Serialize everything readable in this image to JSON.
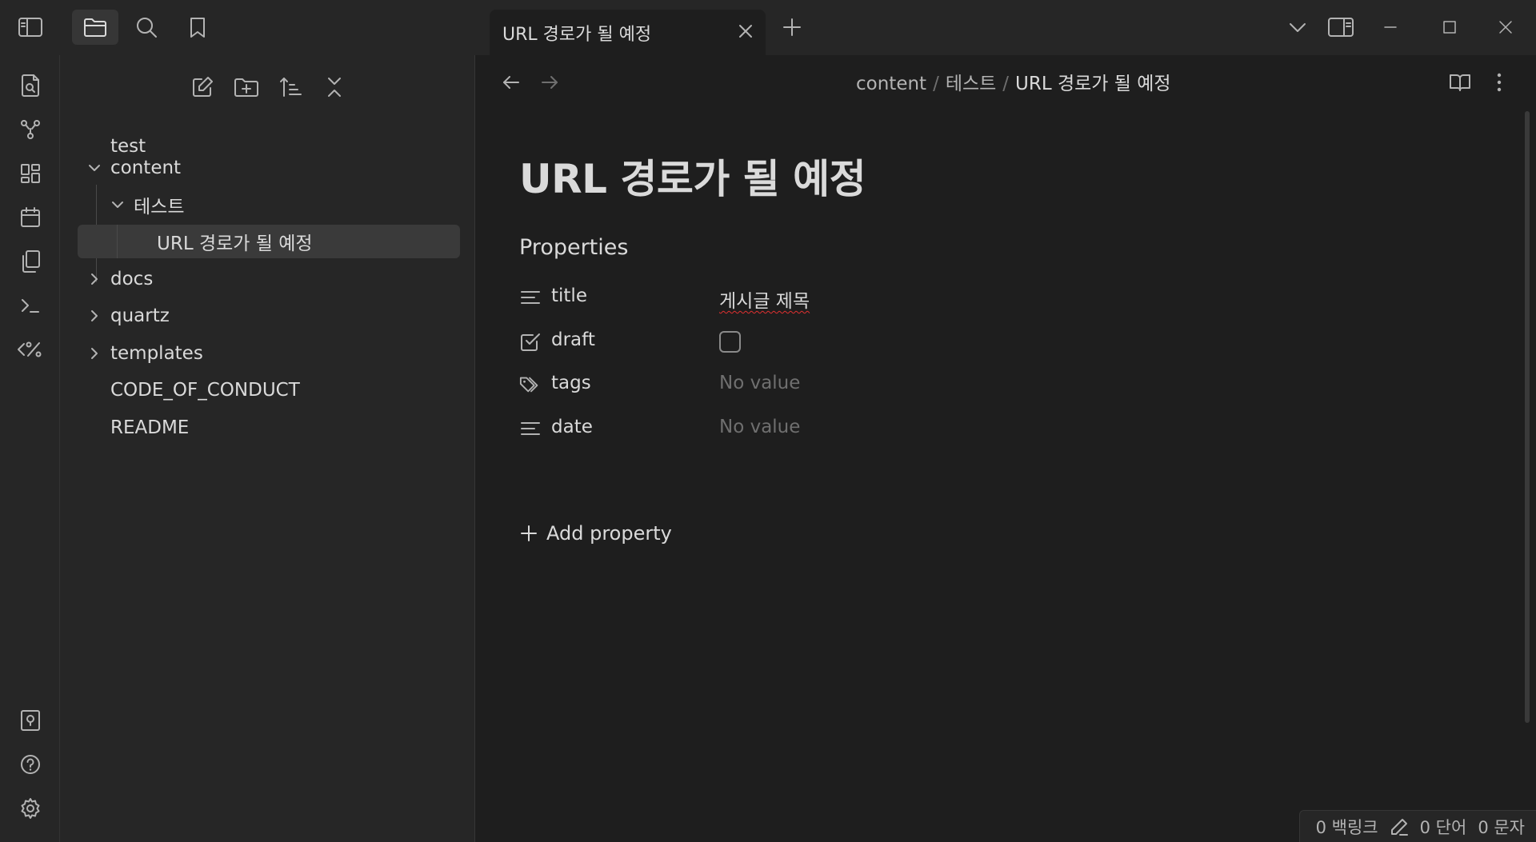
{
  "tab": {
    "title": "URL 경로가 될 예정"
  },
  "explorer": {
    "items": [
      {
        "label": "test"
      },
      {
        "label": "content"
      },
      {
        "label": "테스트"
      },
      {
        "label": "URL 경로가 될 예정"
      },
      {
        "label": "docs"
      },
      {
        "label": "quartz"
      },
      {
        "label": "templates"
      },
      {
        "label": "CODE_OF_CONDUCT"
      },
      {
        "label": "README"
      }
    ]
  },
  "breadcrumb": {
    "parts": [
      "content",
      "테스트",
      "URL 경로가 될 예정"
    ],
    "separator": "/"
  },
  "document": {
    "title": "URL 경로가 될 예정",
    "properties_heading": "Properties",
    "properties": [
      {
        "key": "title",
        "value": "게시글 제목",
        "icon": "text-lines-icon"
      },
      {
        "key": "draft",
        "value": "",
        "icon": "checkbox-icon",
        "checked": false
      },
      {
        "key": "tags",
        "value": "No value",
        "icon": "tags-icon"
      },
      {
        "key": "date",
        "value": "No value",
        "icon": "text-lines-icon"
      }
    ],
    "add_property_label": "Add property"
  },
  "status": {
    "backlinks": "0 백링크",
    "words": "0 단어",
    "chars": "0 문자"
  },
  "colors": {
    "background": "#1e1e1e",
    "panel": "#262626",
    "selected": "#3a3a3a",
    "text": "#dadada",
    "muted": "#6f6f6f"
  }
}
